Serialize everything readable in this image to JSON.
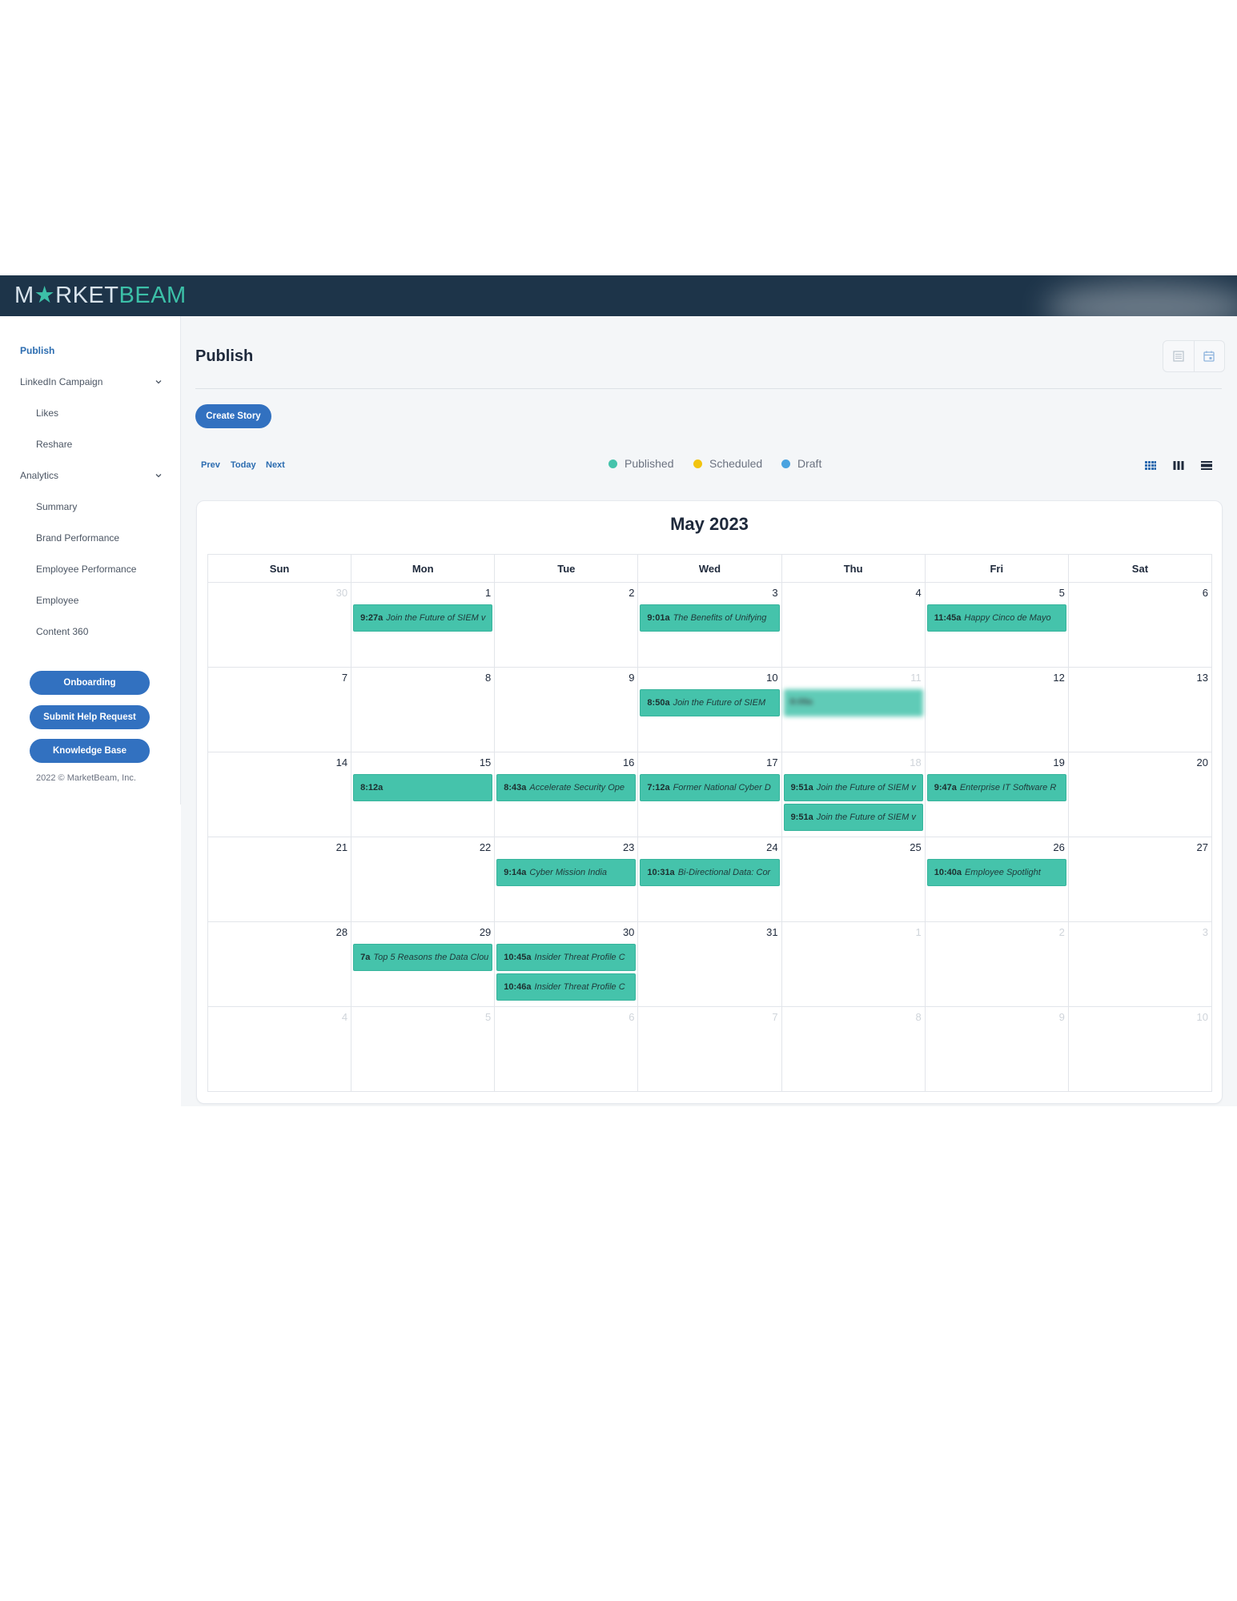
{
  "brand": {
    "logo_part1": "M",
    "logo_star": "★",
    "logo_part2": "RKET",
    "logo_part3": "BEAM"
  },
  "sidebar": {
    "items": [
      {
        "label": "Publish",
        "active": true
      },
      {
        "label": "LinkedIn Campaign",
        "expandable": true
      },
      {
        "label": "Likes",
        "sub": true
      },
      {
        "label": "Reshare",
        "sub": true
      },
      {
        "label": "Analytics",
        "expandable": true
      },
      {
        "label": "Summary",
        "sub": true
      },
      {
        "label": "Brand Performance",
        "sub": true
      },
      {
        "label": "Employee Performance",
        "sub": true
      },
      {
        "label": "Employee",
        "sub": true
      },
      {
        "label": "Content 360",
        "sub": true
      }
    ],
    "buttons": [
      "Onboarding",
      "Submit Help Request",
      "Knowledge Base"
    ],
    "copyright": "2022 © MarketBeam, Inc."
  },
  "page": {
    "title": "Publish",
    "create_button": "Create Story"
  },
  "calendar_nav": {
    "prev": "Prev",
    "today": "Today",
    "next": "Next"
  },
  "legend": [
    {
      "label": "Published",
      "color": "#45c3ab"
    },
    {
      "label": "Scheduled",
      "color": "#f2c40f"
    },
    {
      "label": "Draft",
      "color": "#4aa3e0"
    }
  ],
  "calendar": {
    "month_title": "May 2023",
    "weekdays": [
      "Sun",
      "Mon",
      "Tue",
      "Wed",
      "Thu",
      "Fri",
      "Sat"
    ],
    "weeks": [
      [
        {
          "d": "30",
          "other": true
        },
        {
          "d": "1"
        },
        {
          "d": "2"
        },
        {
          "d": "3"
        },
        {
          "d": "4"
        },
        {
          "d": "5"
        },
        {
          "d": "6"
        }
      ],
      [
        {
          "d": "7"
        },
        {
          "d": "8"
        },
        {
          "d": "9"
        },
        {
          "d": "10"
        },
        {
          "d": "11",
          "other": true
        },
        {
          "d": "12"
        },
        {
          "d": "13"
        }
      ],
      [
        {
          "d": "14"
        },
        {
          "d": "15"
        },
        {
          "d": "16"
        },
        {
          "d": "17"
        },
        {
          "d": "18",
          "other": true
        },
        {
          "d": "19"
        },
        {
          "d": "20"
        }
      ],
      [
        {
          "d": "21"
        },
        {
          "d": "22"
        },
        {
          "d": "23"
        },
        {
          "d": "24"
        },
        {
          "d": "25"
        },
        {
          "d": "26"
        },
        {
          "d": "27"
        }
      ],
      [
        {
          "d": "28"
        },
        {
          "d": "29"
        },
        {
          "d": "30"
        },
        {
          "d": "31"
        },
        {
          "d": "1",
          "other": true
        },
        {
          "d": "2",
          "other": true
        },
        {
          "d": "3",
          "other": true
        }
      ],
      [
        {
          "d": "4",
          "other": true
        },
        {
          "d": "5",
          "other": true
        },
        {
          "d": "6",
          "other": true
        },
        {
          "d": "7",
          "other": true
        },
        {
          "d": "8",
          "other": true
        },
        {
          "d": "9",
          "other": true
        },
        {
          "d": "10",
          "other": true
        }
      ]
    ],
    "events": [
      {
        "week": 0,
        "day": 1,
        "slot": 0,
        "time": "9:27a",
        "title": "Join the Future of SIEM v"
      },
      {
        "week": 0,
        "day": 3,
        "slot": 0,
        "time": "9:01a",
        "title": "The Benefits of Unifying"
      },
      {
        "week": 0,
        "day": 5,
        "slot": 0,
        "time": "11:45a",
        "title": "Happy Cinco de Mayo"
      },
      {
        "week": 1,
        "day": 3,
        "slot": 0,
        "time": "8:50a",
        "title": "Join the Future of SIEM"
      },
      {
        "week": 1,
        "day": 4,
        "slot": 0,
        "time": "8:09a",
        "title": "",
        "blurred": true
      },
      {
        "week": 2,
        "day": 1,
        "slot": 0,
        "time": "8:12a",
        "title": ""
      },
      {
        "week": 2,
        "day": 2,
        "slot": 0,
        "time": "8:43a",
        "title": "Accelerate Security Ope"
      },
      {
        "week": 2,
        "day": 3,
        "slot": 0,
        "time": "7:12a",
        "title": "Former National Cyber D"
      },
      {
        "week": 2,
        "day": 4,
        "slot": 0,
        "time": "9:51a",
        "title": "Join the Future of SIEM v"
      },
      {
        "week": 2,
        "day": 4,
        "slot": 1,
        "time": "9:51a",
        "title": "Join the Future of SIEM v"
      },
      {
        "week": 2,
        "day": 5,
        "slot": 0,
        "time": "9:47a",
        "title": "Enterprise IT Software R"
      },
      {
        "week": 3,
        "day": 2,
        "slot": 0,
        "time": "9:14a",
        "title": "Cyber Mission India"
      },
      {
        "week": 3,
        "day": 3,
        "slot": 0,
        "time": "10:31a",
        "title": "Bi-Directional Data: Cor"
      },
      {
        "week": 3,
        "day": 5,
        "slot": 0,
        "time": "10:40a",
        "title": "Employee Spotlight"
      },
      {
        "week": 4,
        "day": 1,
        "slot": 0,
        "time": "7a",
        "title": "Top 5 Reasons the Data Clou"
      },
      {
        "week": 4,
        "day": 2,
        "slot": 0,
        "time": "10:45a",
        "title": "Insider Threat Profile C"
      },
      {
        "week": 4,
        "day": 2,
        "slot": 1,
        "time": "10:46a",
        "title": "Insider Threat Profile C"
      }
    ]
  }
}
